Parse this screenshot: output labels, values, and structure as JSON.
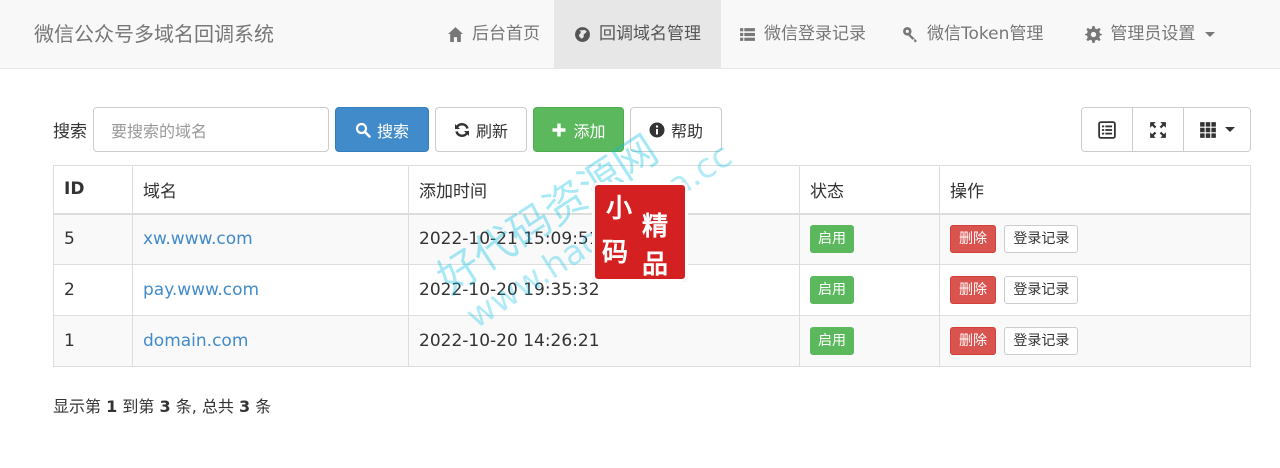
{
  "navbar": {
    "brand": "微信公众号多域名回调系统",
    "items": [
      {
        "label": "后台首页",
        "icon": "home-icon",
        "active": false
      },
      {
        "label": "回调域名管理",
        "icon": "globe-icon",
        "active": true
      },
      {
        "label": "微信登录记录",
        "icon": "list-icon",
        "active": false
      },
      {
        "label": "微信Token管理",
        "icon": "key-icon",
        "active": false
      },
      {
        "label": "管理员设置",
        "icon": "gear-icon",
        "active": false
      }
    ]
  },
  "toolbar": {
    "search_label": "搜索",
    "search_placeholder": "要搜索的域名",
    "search_button": "搜索",
    "refresh_button": "刷新",
    "add_button": "添加",
    "help_button": "帮助"
  },
  "table": {
    "headers": [
      "ID",
      "域名",
      "添加时间",
      "状态",
      "操作"
    ],
    "rows": [
      {
        "id": "5",
        "domain": "xw.www.com",
        "time": "2022-10-21 15:09:51",
        "status": "启用",
        "delete": "删除",
        "log": "登录记录"
      },
      {
        "id": "2",
        "domain": "pay.www.com",
        "time": "2022-10-20 19:35:32",
        "status": "启用",
        "delete": "删除",
        "log": "登录记录"
      },
      {
        "id": "1",
        "domain": "domain.com",
        "time": "2022-10-20 14:26:21",
        "status": "启用",
        "delete": "删除",
        "log": "登录记录"
      }
    ]
  },
  "pagination": {
    "prefix": "显示第",
    "from": "1",
    "mid": "到第",
    "to": "3",
    "mid2": "条, 总共",
    "total": "3",
    "suffix": "条"
  },
  "watermark": {
    "line1": "好代码资源网",
    "line2": "www.haodaima.cc",
    "seal": [
      "小",
      "精",
      "码",
      "品"
    ]
  },
  "colors": {
    "primary": "#428bca",
    "success": "#5cb85c",
    "danger": "#d9534f"
  }
}
